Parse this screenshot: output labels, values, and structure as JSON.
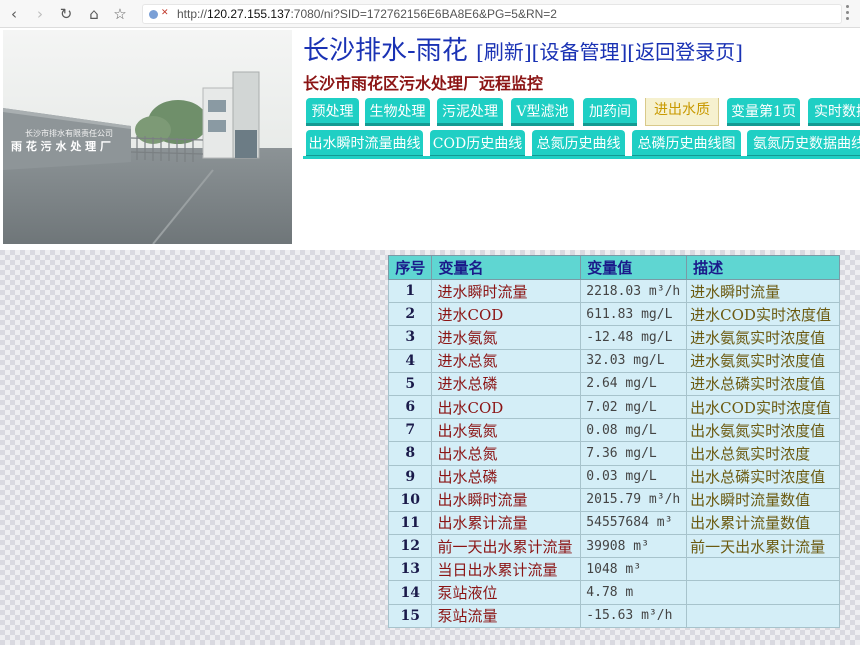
{
  "browser": {
    "url_prefix": "http://",
    "url_host": "120.27.155.137",
    "url_rest": ":7080/ni?SID=172762156E6BA8E6&PG=5&RN=2",
    "icons": [
      "back-arrow-icon",
      "forward-arrow-icon",
      "reload-icon",
      "home-icon",
      "star-icon",
      "lock-icon",
      "menu-dots-icon"
    ]
  },
  "photo": {
    "sign_line1": "长沙市排水有限责任公司",
    "sign_line2": "雨 花 污 水 处 理 厂"
  },
  "header": {
    "title": "长沙排水-雨花",
    "link_refresh": "[刷新]",
    "link_device": "[设备管理]",
    "link_login": "[返回登录页]",
    "subtitle": "长沙市雨花区污水处理厂远程监控"
  },
  "tabs_row1": [
    "预处理",
    "生物处理",
    "污泥处理",
    "V型滤池",
    "加药间",
    "进出水质",
    "变量第1页",
    "实时数据"
  ],
  "tabs_row2": [
    "出水瞬时流量曲线",
    "COD历史曲线",
    "总氮历史曲线",
    "总磷历史曲线图",
    "氨氮历史数据曲线"
  ],
  "active_tab": "进出水质",
  "table": {
    "headers": [
      "序号",
      "变量名",
      "变量值",
      "描述"
    ],
    "rows": [
      {
        "no": "1",
        "name": "进水瞬时流量",
        "value": "2218.03 m³/h",
        "desc": "进水瞬时流量"
      },
      {
        "no": "2",
        "name": "进水COD",
        "value": "611.83 mg/L",
        "desc": "进水COD实时浓度值"
      },
      {
        "no": "3",
        "name": "进水氨氮",
        "value": "-12.48 mg/L",
        "desc": "进水氨氮实时浓度值"
      },
      {
        "no": "4",
        "name": "进水总氮",
        "value": "32.03 mg/L",
        "desc": "进水氨氮实时浓度值"
      },
      {
        "no": "5",
        "name": "进水总磷",
        "value": "2.64 mg/L",
        "desc": "进水总磷实时浓度值"
      },
      {
        "no": "6",
        "name": "出水COD",
        "value": "7.02 mg/L",
        "desc": "出水COD实时浓度值"
      },
      {
        "no": "7",
        "name": "出水氨氮",
        "value": "0.08 mg/L",
        "desc": "出水氨氮实时浓度值"
      },
      {
        "no": "8",
        "name": "出水总氮",
        "value": "7.36 mg/L",
        "desc": "出水总氮实时浓度"
      },
      {
        "no": "9",
        "name": "出水总磷",
        "value": "0.03 mg/L",
        "desc": "出水总磷实时浓度值"
      },
      {
        "no": "10",
        "name": "出水瞬时流量",
        "value": "2015.79 m³/h",
        "desc": "出水瞬时流量数值"
      },
      {
        "no": "11",
        "name": "出水累计流量",
        "value": "54557684 m³",
        "desc": "出水累计流量数值"
      },
      {
        "no": "12",
        "name": "前一天出水累计流量",
        "value": "39908 m³",
        "desc": "前一天出水累计流量"
      },
      {
        "no": "13",
        "name": "当日出水累计流量",
        "value": "1048 m³",
        "desc": ""
      },
      {
        "no": "14",
        "name": "泵站液位",
        "value": "4.78 m",
        "desc": ""
      },
      {
        "no": "15",
        "name": "泵站流量",
        "value": "-15.63 m³/h",
        "desc": ""
      }
    ]
  },
  "colors": {
    "title_blue": "#1a32b4",
    "subtitle_red": "#8b1414",
    "tab_teal": "#1fcfc4",
    "active_tab_bg": "#f6f1cf",
    "table_bg": "#d4eef7",
    "table_header": "#5fd6d2"
  }
}
